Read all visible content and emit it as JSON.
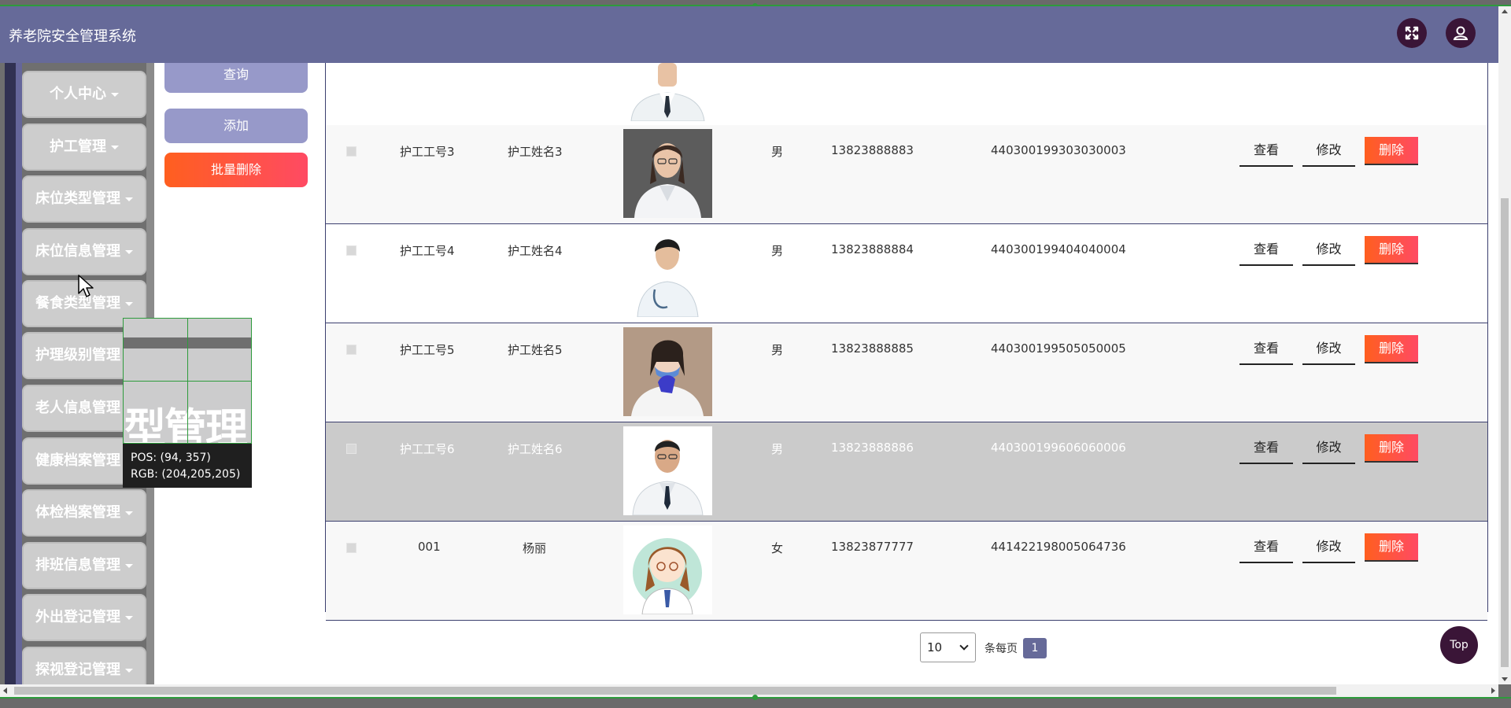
{
  "header": {
    "title": "养老院安全管理系统"
  },
  "icons": {
    "expand": "expand-icon",
    "user": "user-icon"
  },
  "sidebar": {
    "items": [
      {
        "label": "个人中心"
      },
      {
        "label": "护工管理"
      },
      {
        "label": "床位类型管理"
      },
      {
        "label": "床位信息管理"
      },
      {
        "label": "餐食类型管理"
      },
      {
        "label": "护理级别管理"
      },
      {
        "label": "老人信息管理"
      },
      {
        "label": "健康档案管理"
      },
      {
        "label": "体检档案管理"
      },
      {
        "label": "排班信息管理"
      },
      {
        "label": "外出登记管理"
      },
      {
        "label": "探视登记管理"
      }
    ]
  },
  "actions": {
    "query": "查询",
    "add": "添加",
    "batch_delete": "批量删除"
  },
  "table": {
    "row_buttons": {
      "view": "查看",
      "edit": "修改",
      "delete": "删除"
    },
    "rows": [
      {
        "id": "护工工号3",
        "name": "护工姓名3",
        "gender": "男",
        "phone": "13823888883",
        "idcard": "440300199303030003"
      },
      {
        "id": "护工工号4",
        "name": "护工姓名4",
        "gender": "男",
        "phone": "13823888884",
        "idcard": "440300199404040004"
      },
      {
        "id": "护工工号5",
        "name": "护工姓名5",
        "gender": "男",
        "phone": "13823888885",
        "idcard": "440300199505050005"
      },
      {
        "id": "护工工号6",
        "name": "护工姓名6",
        "gender": "男",
        "phone": "13823888886",
        "idcard": "440300199606060006"
      },
      {
        "id": "001",
        "name": "杨丽",
        "gender": "女",
        "phone": "13823877777",
        "idcard": "441422198005064736"
      }
    ]
  },
  "pager": {
    "page_size": "10",
    "per_page_label": "条每页",
    "current_page": "1"
  },
  "top_button": "Top",
  "magnifier": {
    "text": "型管理",
    "pos": "POS:  (94, 357)",
    "rgb": "RGB:  (204,205,205)"
  }
}
